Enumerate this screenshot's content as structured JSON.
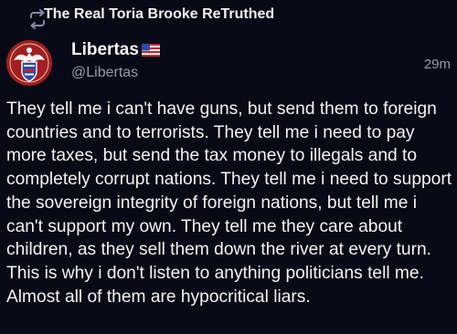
{
  "retruth": {
    "icon": "retruth-icon",
    "label": "The Real Toria Brooke ReTruthed"
  },
  "author": {
    "avatar_icon": "eagle-shield-avatar",
    "display_name": "Libertas",
    "flag_icon": "us-flag-icon",
    "handle": "@Libertas"
  },
  "post": {
    "timestamp": "29m",
    "text": "They tell me i can't have guns, but send them to foreign countries and to terrorists. They tell me i need to pay more taxes, but send the tax money to illegals and to completely corrupt nations. They tell me i need to support the sovereign integrity of foreign nations, but tell me i can't support my own. They tell me they care about children, as they sell them down the river at every turn. This is why i don't listen to anything politicians tell me. Almost all of them are hypocritical liars."
  },
  "colors": {
    "background": "#0a0a16",
    "text_primary": "#f2f2f6",
    "text_secondary": "#9a9aa8",
    "avatar_red": "#a11e22"
  }
}
